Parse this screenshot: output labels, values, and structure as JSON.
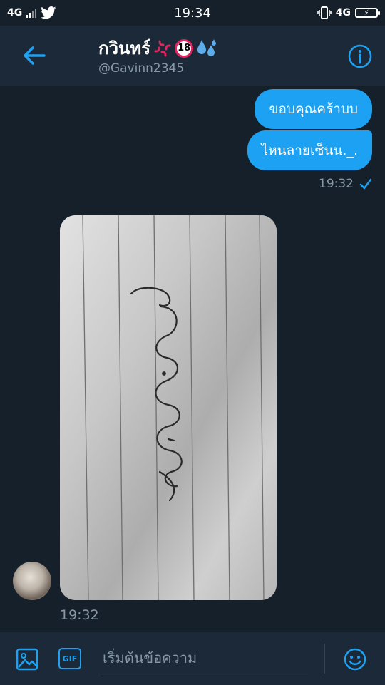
{
  "status_bar": {
    "network_left": "4G",
    "time": "19:34",
    "network_right": "4G",
    "colors": {
      "background": "#15202b",
      "text": "#ffffff"
    }
  },
  "header": {
    "name": "กวินทร์",
    "emoji_18": "18",
    "handle": "@Gavinn2345",
    "icons": {
      "back": "back-arrow-icon",
      "info": "info-icon"
    }
  },
  "messages": {
    "outgoing": [
      {
        "text": "ขอบคุณคร้าบบ"
      },
      {
        "text": "ไหนลายเซ็นน._."
      }
    ],
    "outgoing_time": "19:32",
    "incoming_time": "19:32",
    "incoming_photo": "signature-photo"
  },
  "composer": {
    "placeholder": "เริ่มต้นข้อความ",
    "gif_label": "GIF",
    "icons": {
      "image": "image-icon",
      "gif": "gif-icon",
      "emoji": "emoji-icon"
    }
  },
  "colors": {
    "accent": "#1da1f2",
    "background": "#15202b",
    "header": "#1c2938",
    "muted": "#8899a6"
  }
}
